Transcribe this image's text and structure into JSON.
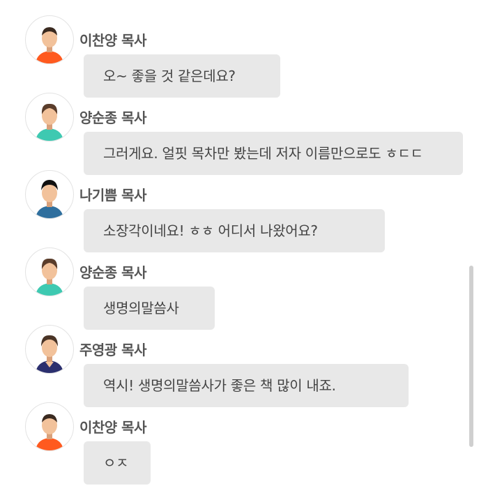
{
  "messages": [
    {
      "avatar": "man-orange-shirt-avatar",
      "name": "이찬양 목사",
      "text": "오~ 좋을 것 같은데요?"
    },
    {
      "avatar": "man-teal-shirt-avatar",
      "name": "양순종 목사",
      "text": "그러게요. 얼핏 목차만 봤는데 저자 이름만으로도 ㅎㄷㄷ"
    },
    {
      "avatar": "man-blue-shirt-avatar",
      "name": "나기쁨 목사",
      "text": "소장각이네요! ㅎㅎ 어디서 나왔어요?"
    },
    {
      "avatar": "man-teal-shirt-avatar",
      "name": "양순종 목사",
      "text": "생명의말씀사"
    },
    {
      "avatar": "man-navy-shirt-avatar",
      "name": "주영광 목사",
      "text": "역시! 생명의말씀사가 좋은 책 많이 내죠."
    },
    {
      "avatar": "man-orange-shirt-avatar",
      "name": "이찬양 목사",
      "text": "ㅇㅈ"
    }
  ],
  "colors": {
    "bubble": "#e8e8e8",
    "name_text": "#555555",
    "message_text": "#444444",
    "scrollbar": "#cfcfcf"
  }
}
